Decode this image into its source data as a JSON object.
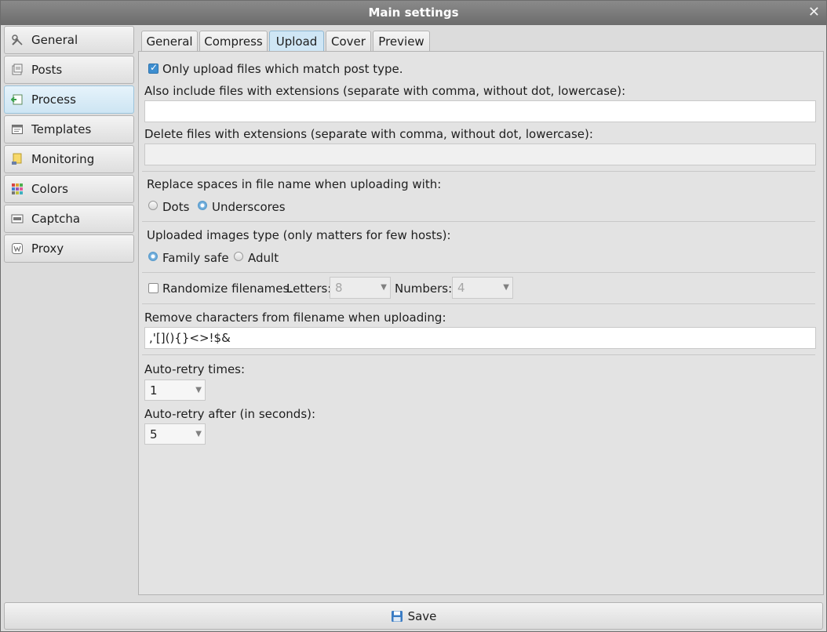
{
  "window": {
    "title": "Main settings",
    "close_glyph": "✕"
  },
  "sidebar": {
    "items": [
      {
        "label": "General",
        "icon": "tools-icon"
      },
      {
        "label": "Posts",
        "icon": "posts-icon"
      },
      {
        "label": "Process",
        "icon": "process-icon",
        "active": true
      },
      {
        "label": "Templates",
        "icon": "templates-icon"
      },
      {
        "label": "Monitoring",
        "icon": "monitoring-icon"
      },
      {
        "label": "Colors",
        "icon": "colors-icon"
      },
      {
        "label": "Captcha",
        "icon": "captcha-icon"
      },
      {
        "label": "Proxy",
        "icon": "proxy-icon"
      }
    ]
  },
  "tabs": [
    {
      "label": "General"
    },
    {
      "label": "Compress"
    },
    {
      "label": "Upload",
      "active": true
    },
    {
      "label": "Cover"
    },
    {
      "label": "Preview"
    }
  ],
  "upload": {
    "only_match_label": "Only upload files which match post type.",
    "only_match_checked": true,
    "include_ext_label": "Also include files with extensions (separate with comma, without dot, lowercase):",
    "include_ext_value": "",
    "delete_ext_label": "Delete files with extensions (separate with comma, without dot, lowercase):",
    "delete_ext_value": "",
    "replace_spaces_label": "Replace spaces in file name when uploading with:",
    "replace_options": [
      "Dots",
      "Underscores"
    ],
    "replace_selected": "Underscores",
    "images_type_label": "Uploaded images type (only matters for few hosts):",
    "images_type_options": [
      "Family safe",
      "Adult"
    ],
    "images_type_selected": "Family safe",
    "randomize_label": "Randomize filenames.",
    "randomize_checked": false,
    "letters_label": "Letters:",
    "letters_value": "8",
    "numbers_label": "Numbers:",
    "numbers_value": "4",
    "remove_chars_label": "Remove characters from filename when uploading:",
    "remove_chars_value": ",'[](){}<>!$&",
    "retry_times_label": "Auto-retry times:",
    "retry_times_value": "1",
    "retry_after_label": "Auto-retry after (in seconds):",
    "retry_after_value": "5"
  },
  "footer": {
    "save_label": "Save"
  },
  "colors": {
    "accent": "#3d8ed0",
    "titlebar": "#7a7a7a",
    "active_item": "#cde5f3"
  }
}
